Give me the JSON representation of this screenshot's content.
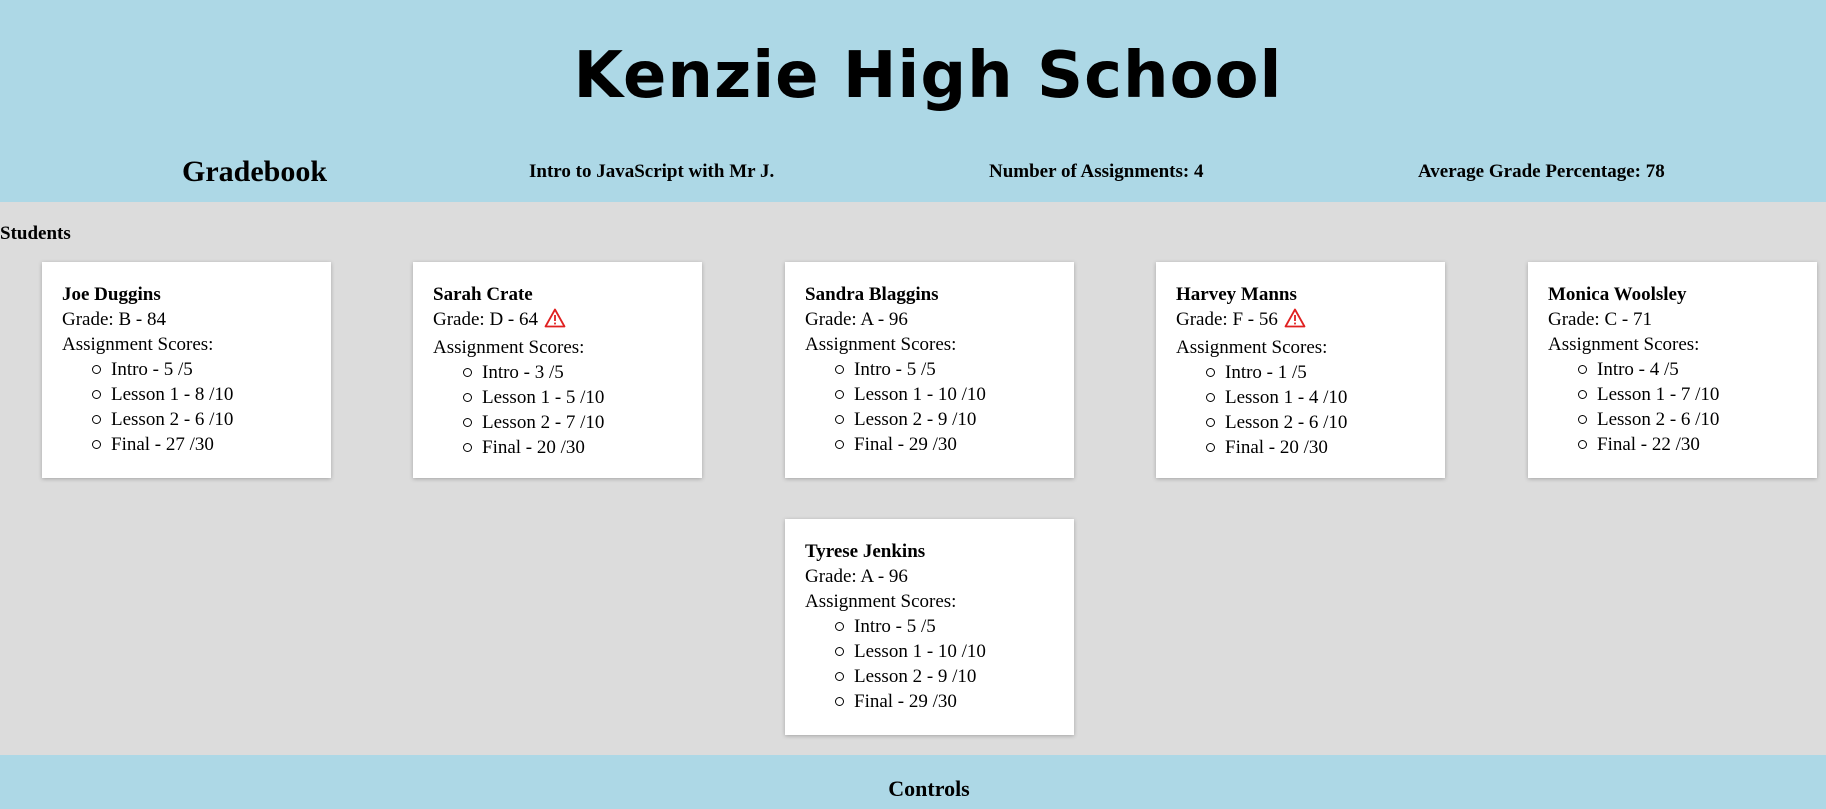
{
  "header": {
    "school_name": "Kenzie High School",
    "gradebook_title": "Gradebook",
    "course": "Intro to JavaScript with Mr J.",
    "assignment_count": "Number of Assignments: 4",
    "average_grade": "Average Grade Percentage: 78"
  },
  "colors": {
    "header_bg": "#add8e6",
    "page_bg": "#dcdcdc",
    "card_bg": "#ffffff",
    "warning": "#e02020"
  },
  "students_label": "Students",
  "scores_label": "Assignment Scores:",
  "students": [
    {
      "name": "Joe Duggins",
      "grade": "Grade: B - 84",
      "warning": false,
      "scores": [
        "Intro - 5 /5",
        "Lesson 1 - 8 /10",
        "Lesson 2 - 6 /10",
        "Final - 27 /30"
      ]
    },
    {
      "name": "Sarah Crate",
      "grade": "Grade: D - 64",
      "warning": true,
      "scores": [
        "Intro - 3 /5",
        "Lesson 1 - 5 /10",
        "Lesson 2 - 7 /10",
        "Final - 20 /30"
      ]
    },
    {
      "name": "Sandra Blaggins",
      "grade": "Grade: A - 96",
      "warning": false,
      "scores": [
        "Intro - 5 /5",
        "Lesson 1 - 10 /10",
        "Lesson 2 - 9 /10",
        "Final - 29 /30"
      ]
    },
    {
      "name": "Harvey Manns",
      "grade": "Grade: F - 56",
      "warning": true,
      "scores": [
        "Intro - 1 /5",
        "Lesson 1 - 4 /10",
        "Lesson 2 - 6 /10",
        "Final - 20 /30"
      ]
    },
    {
      "name": "Monica Woolsley",
      "grade": "Grade: C - 71",
      "warning": false,
      "scores": [
        "Intro - 4 /5",
        "Lesson 1 - 7 /10",
        "Lesson 2 - 6 /10",
        "Final - 22 /30"
      ]
    },
    {
      "name": "Tyrese Jenkins",
      "grade": "Grade: A - 96",
      "warning": false,
      "scores": [
        "Intro - 5 /5",
        "Lesson 1 - 10 /10",
        "Lesson 2 - 9 /10",
        "Final - 29 /30"
      ]
    }
  ],
  "footer": {
    "controls_label": "Controls"
  }
}
